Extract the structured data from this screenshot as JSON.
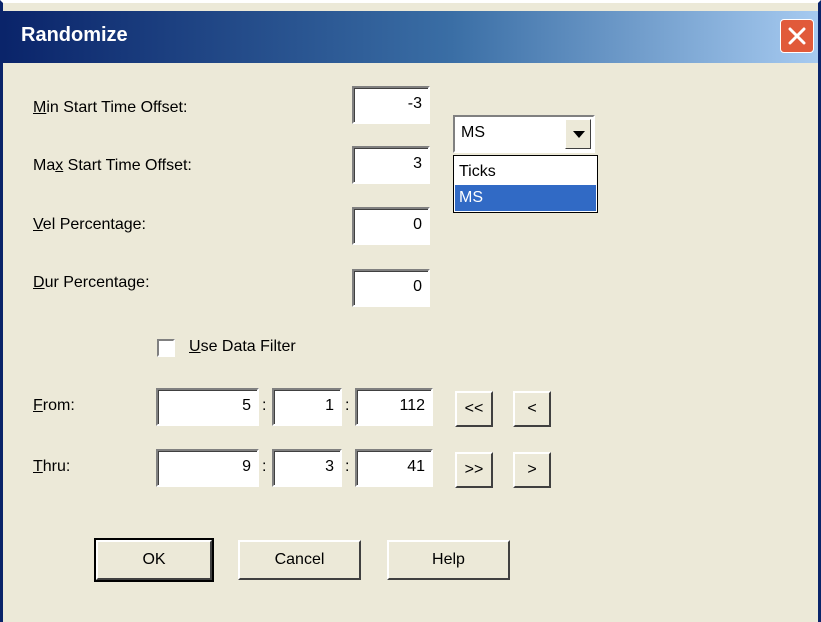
{
  "window": {
    "title": "Randomize"
  },
  "fields": {
    "min_start": {
      "label": "Min Start Time Offset:",
      "value": "-3"
    },
    "max_start": {
      "label": "Max Start Time Offset:",
      "value": "3"
    },
    "vel_pct": {
      "label": "Vel Percentage:",
      "value": "0"
    },
    "dur_pct": {
      "label": "Dur Percentage:",
      "value": "0"
    }
  },
  "units": {
    "selected": "MS",
    "options": [
      "Ticks",
      "MS"
    ]
  },
  "data_filter": {
    "label": "Use Data Filter",
    "checked": false
  },
  "from": {
    "label": "From:",
    "bar": "5",
    "beat": "1",
    "tick": "112",
    "btn_first": "<<",
    "btn_prev": "<"
  },
  "thru": {
    "label": "Thru:",
    "bar": "9",
    "beat": "3",
    "tick": "41",
    "btn_last": ">>",
    "btn_next": ">"
  },
  "buttons": {
    "ok": "OK",
    "cancel": "Cancel",
    "help": "Help"
  }
}
